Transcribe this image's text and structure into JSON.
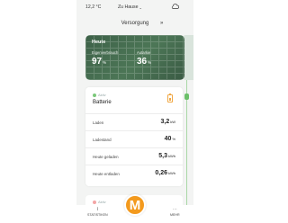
{
  "status_bar": {
    "temperature": "12,2 °C",
    "location": "Zu Hause",
    "location_chevron": "chevron-down-icon",
    "weather_icon": "cloud-icon"
  },
  "section": {
    "title": "Versorgung",
    "next_icon": "double-chevron-right-icon"
  },
  "today_card": {
    "title": "Heute",
    "self_consumption_label": "Eigenverbrauch",
    "self_consumption_value": "97",
    "self_consumption_unit": "%",
    "autarky_label": "Autarkie",
    "autarky_value": "36",
    "autarky_unit": "%"
  },
  "battery_card": {
    "status": "Aktiv",
    "name": "Batterie",
    "icon": "battery-icon",
    "rows": [
      {
        "label": "Laden",
        "value": "3,2",
        "unit": "kW"
      },
      {
        "label": "Ladestand",
        "value": "40",
        "unit": "%"
      },
      {
        "label": "Heute geladen",
        "value": "5,3",
        "unit": "kWh"
      },
      {
        "label": "Heute entladen",
        "value": "0,26",
        "unit": "kWh"
      }
    ]
  },
  "next_card": {
    "status": "Aktiv"
  },
  "bottom_nav": {
    "left_label": "STATISTIKEN",
    "left_icon": "statistics-icon",
    "right_label": "MEHR",
    "right_icon": "more-icon",
    "center_logo": "M"
  },
  "colors": {
    "accent": "#f39a1e",
    "card_green": "#4c7656",
    "active_dot": "#7bc87a"
  }
}
